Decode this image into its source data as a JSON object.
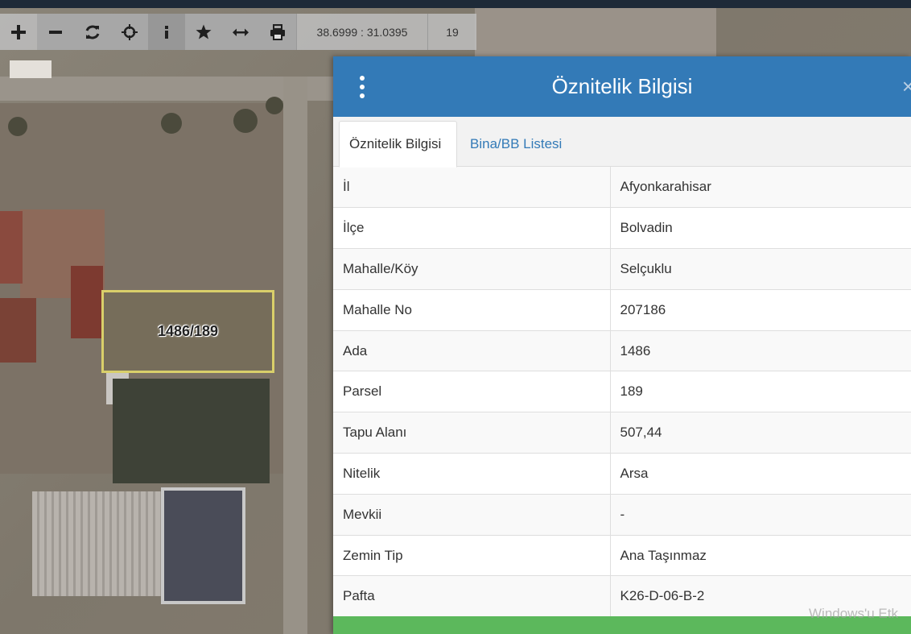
{
  "toolbar": {
    "buttons": [
      {
        "name": "zoom-in",
        "glyph": "+"
      },
      {
        "name": "zoom-out",
        "glyph": "−"
      },
      {
        "name": "refresh",
        "glyph": "↻"
      },
      {
        "name": "locate",
        "glyph": "⌖"
      },
      {
        "name": "info",
        "glyph": "i"
      },
      {
        "name": "favorite",
        "glyph": "★"
      },
      {
        "name": "measure",
        "glyph": "⟷"
      },
      {
        "name": "print",
        "glyph": "🖶"
      }
    ],
    "coordinates": "38.6999 : 31.0395",
    "zoom_level": "19"
  },
  "map": {
    "parcel_label": "1486/189"
  },
  "panel": {
    "title": "Öznitelik Bilgisi",
    "tabs": [
      {
        "label": "Öznitelik Bilgisi",
        "active": true
      },
      {
        "label": "Bina/BB Listesi",
        "active": false
      }
    ],
    "rows": [
      {
        "key": "İl",
        "value": "Afyonkarahisar"
      },
      {
        "key": "İlçe",
        "value": "Bolvadin"
      },
      {
        "key": "Mahalle/Köy",
        "value": "Selçuklu"
      },
      {
        "key": "Mahalle No",
        "value": "207186"
      },
      {
        "key": "Ada",
        "value": "1486"
      },
      {
        "key": "Parsel",
        "value": "189"
      },
      {
        "key": "Tapu Alanı",
        "value": "507,44"
      },
      {
        "key": "Nitelik",
        "value": "Arsa"
      },
      {
        "key": "Mevkii",
        "value": "-"
      },
      {
        "key": "Zemin Tip",
        "value": "Ana Taşınmaz"
      },
      {
        "key": "Pafta",
        "value": "K26-D-06-B-2"
      }
    ]
  },
  "watermark": "Windows'u Etk",
  "colors": {
    "header_blue": "#337ab7",
    "footer_green": "#5cb85c",
    "parcel_outline": "#d9cf6a"
  }
}
